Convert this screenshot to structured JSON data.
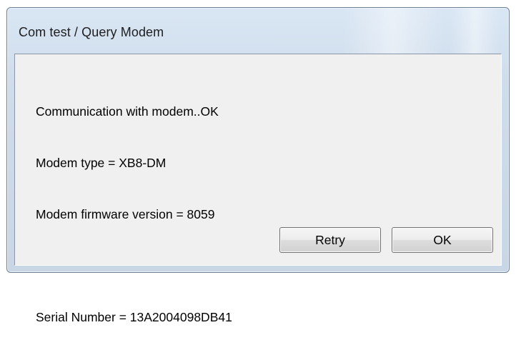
{
  "window": {
    "title": "Com test / Query Modem"
  },
  "message": {
    "line1": "Communication with modem..OK",
    "line2": "Modem type = XB8-DM",
    "line3": "Modem firmware version = 8059",
    "line4": "Serial Number = 13A2004098DB41"
  },
  "buttons": {
    "retry_label": "Retry",
    "ok_label": "OK"
  },
  "colors": {
    "frame": "#cfdceb",
    "client_background": "#f0f0f0"
  }
}
